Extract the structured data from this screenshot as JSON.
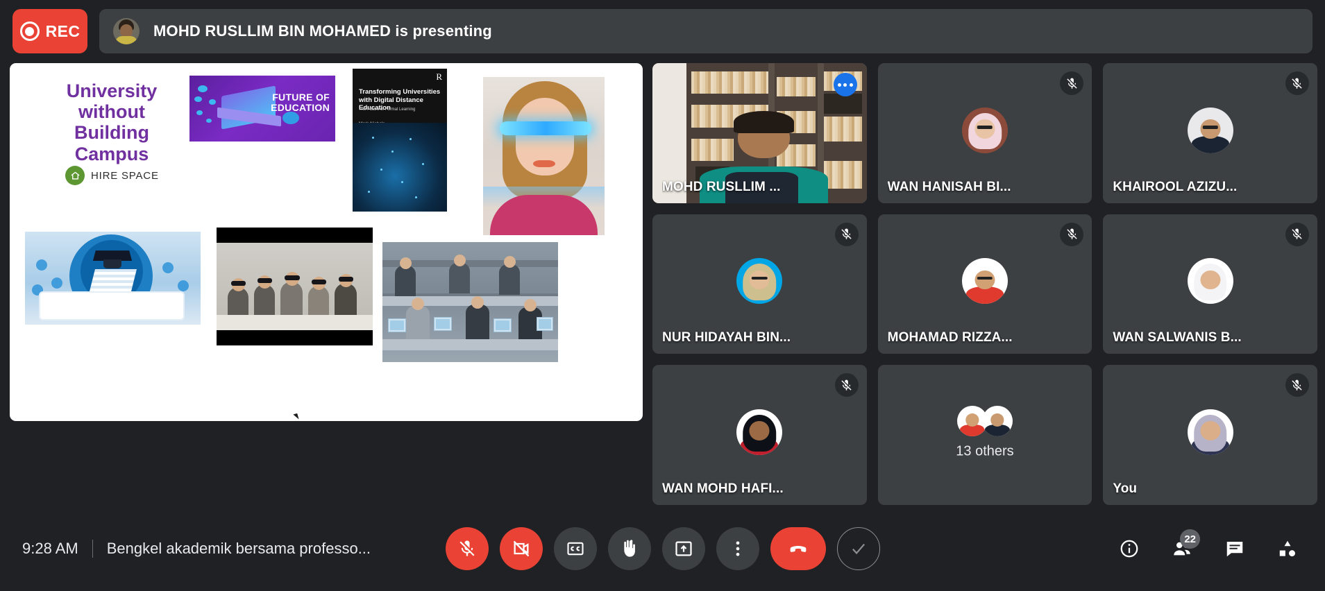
{
  "recording": {
    "label": "REC",
    "icon": "record-dot-icon",
    "color": "#ea4335"
  },
  "presenting": {
    "text": "MOHD RUSLLIM BIN MOHAMED is presenting",
    "avatar": "presenter-avatar"
  },
  "slide": {
    "title_lines": [
      "University",
      "without",
      "Building",
      "Campus"
    ],
    "logo_text": "HIRE SPACE",
    "future_of_education": [
      "FUTURE OF",
      "EDUCATION"
    ],
    "book": {
      "publisher": "R",
      "title": "Transforming Universities with Digital Distance Education",
      "subtitle": "The Future of Formal Learning",
      "author": "Mark Nichols"
    }
  },
  "participants": [
    {
      "name": "MOHD RUSLLIM ...",
      "active": true,
      "muted": false,
      "type": "video",
      "more": true
    },
    {
      "name": "WAN HANISAH BI...",
      "active": false,
      "muted": true,
      "type": "avatar",
      "more": false
    },
    {
      "name": "KHAIROOL AZIZU...",
      "active": false,
      "muted": true,
      "type": "avatar",
      "more": false
    },
    {
      "name": "NUR HIDAYAH BIN...",
      "active": false,
      "muted": true,
      "type": "avatar",
      "more": false
    },
    {
      "name": "MOHAMAD RIZZA...",
      "active": false,
      "muted": true,
      "type": "avatar",
      "more": false
    },
    {
      "name": "WAN SALWANIS B...",
      "active": false,
      "muted": true,
      "type": "avatar",
      "more": false
    },
    {
      "name": "WAN MOHD HAFI...",
      "active": false,
      "muted": true,
      "type": "avatar",
      "more": false
    },
    {
      "name": "",
      "label": "13 others",
      "active": false,
      "muted": false,
      "type": "group",
      "more": false
    },
    {
      "name": "You",
      "active": false,
      "muted": true,
      "type": "avatar",
      "more": false
    }
  ],
  "bottom": {
    "time": "9:28 AM",
    "meeting_name": "Bengkel akademik bersama professo...",
    "controls": [
      {
        "name": "microphone-off-button",
        "icon": "mic-off-icon",
        "style": "danger"
      },
      {
        "name": "camera-off-button",
        "icon": "camera-off-icon",
        "style": "danger"
      },
      {
        "name": "captions-button",
        "icon": "cc-icon",
        "style": "normal"
      },
      {
        "name": "raise-hand-button",
        "icon": "hand-icon",
        "style": "normal"
      },
      {
        "name": "present-screen-button",
        "icon": "present-icon",
        "style": "normal"
      },
      {
        "name": "more-options-button",
        "icon": "more-vertical-icon",
        "style": "normal"
      },
      {
        "name": "end-call-button",
        "icon": "hangup-icon",
        "style": "hangup"
      },
      {
        "name": "confirm-button",
        "icon": "check-icon",
        "style": "ghost"
      }
    ],
    "right_icons": [
      {
        "name": "meeting-details-button",
        "icon": "info-icon",
        "badge": null
      },
      {
        "name": "participants-button",
        "icon": "people-icon",
        "badge": "22"
      },
      {
        "name": "chat-button",
        "icon": "chat-icon",
        "badge": null
      },
      {
        "name": "activities-button",
        "icon": "activities-icon",
        "badge": null
      }
    ]
  }
}
